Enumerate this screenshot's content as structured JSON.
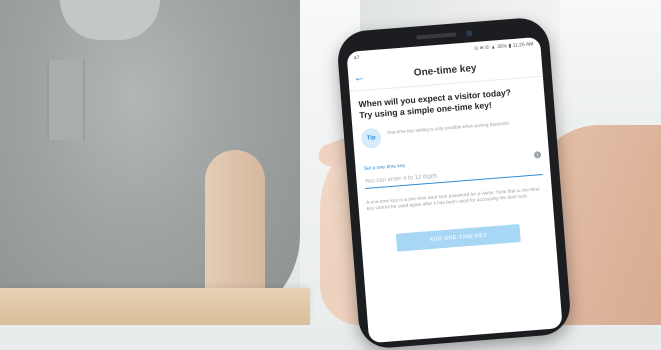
{
  "status_bar": {
    "left": "47",
    "right": "⊙ ✉ ✆ ▲ 35% ▮ 11:25 AM"
  },
  "app_bar": {
    "back_icon": "arrow-left-icon",
    "title": "One-time key"
  },
  "content": {
    "heading_line1": "When will you expect a visitor today?",
    "heading_line2": "Try using a simple one-time key!",
    "tip_badge": "Tip",
    "tip_text": "One-time key setting is only possible when pairing Bluetooth.",
    "field_label": "Set a one-time key",
    "input_placeholder": "You can enter 4 to 12 digits",
    "description": "A one-time key is a one-time door lock password for a visitor. Note that a one-time key cannot be used again after it has been used for accessing the door lock.",
    "add_button": "ADD ONE-TIME KEY"
  },
  "colors": {
    "accent": "#2f8cd6",
    "button_disabled": "#a8d7f6",
    "text_dark": "#23262b",
    "text_muted": "#9aa1a8"
  }
}
